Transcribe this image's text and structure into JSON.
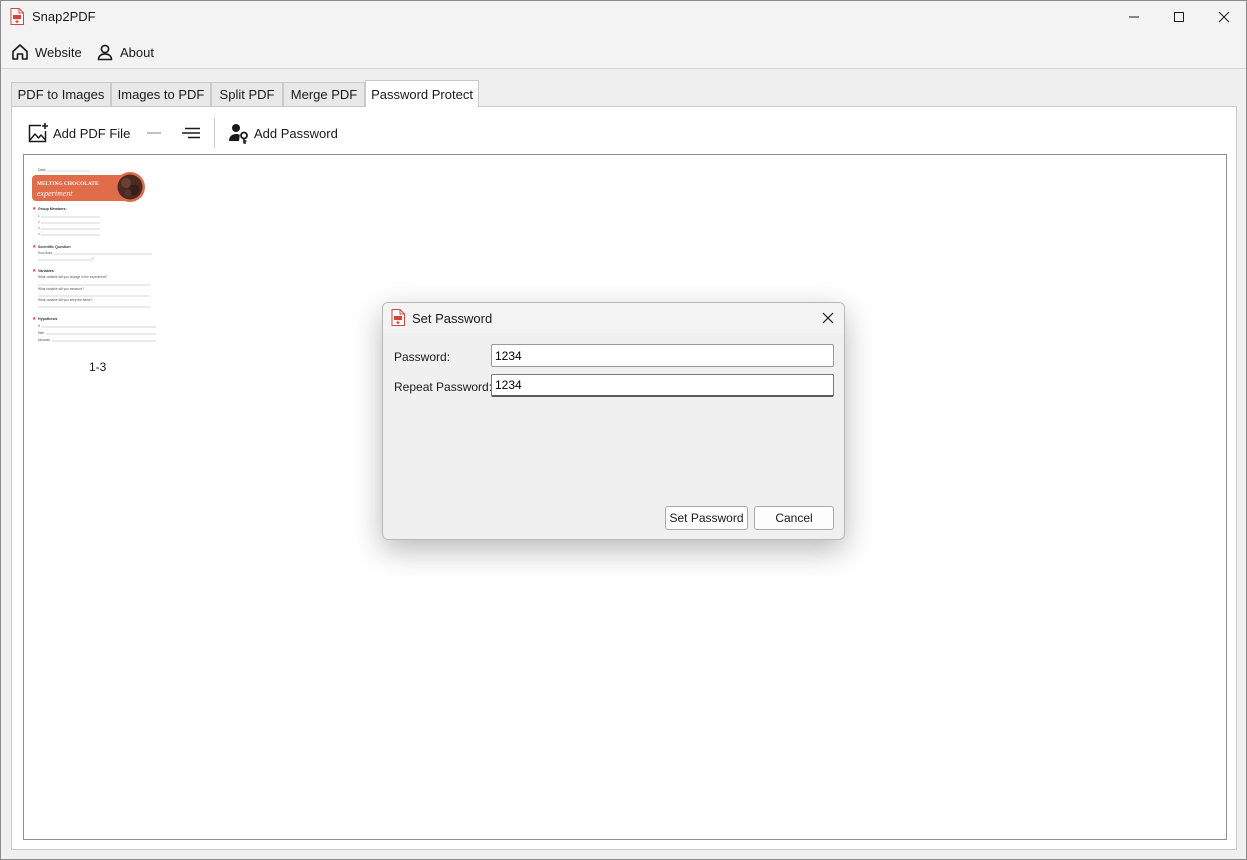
{
  "window": {
    "title": "Snap2PDF",
    "brand_color": "#d9443a"
  },
  "menu": {
    "website": "Website",
    "about": "About"
  },
  "tabs": [
    {
      "label": "PDF to Images"
    },
    {
      "label": "Images to PDF"
    },
    {
      "label": "Split PDF"
    },
    {
      "label": "Merge PDF"
    },
    {
      "label": "Password Protect",
      "active": true
    }
  ],
  "toolbar": {
    "add_pdf": "Add PDF File",
    "add_password": "Add Password"
  },
  "document": {
    "page_range": "1-3",
    "heading_line1": "MELTING CHOCOLATE",
    "heading_line2": "experiment",
    "date_label": "Date:",
    "sections": [
      {
        "title": "Group Members:"
      },
      {
        "title": "Scientific Question"
      },
      {
        "title": "Variables"
      },
      {
        "title": "Hypothesis"
      }
    ],
    "question_prefix": "How does",
    "variables": [
      "What variable will you change in the experiment?",
      "What variable will you measure?",
      "What variable will you keep the same?"
    ],
    "hypothesis": [
      "If",
      "then",
      "because"
    ]
  },
  "dialog": {
    "title": "Set Password",
    "password_label": "Password:",
    "password_value": "1234",
    "repeat_label": "Repeat Password:",
    "repeat_value": "1234",
    "set_button": "Set Password",
    "cancel_button": "Cancel"
  }
}
